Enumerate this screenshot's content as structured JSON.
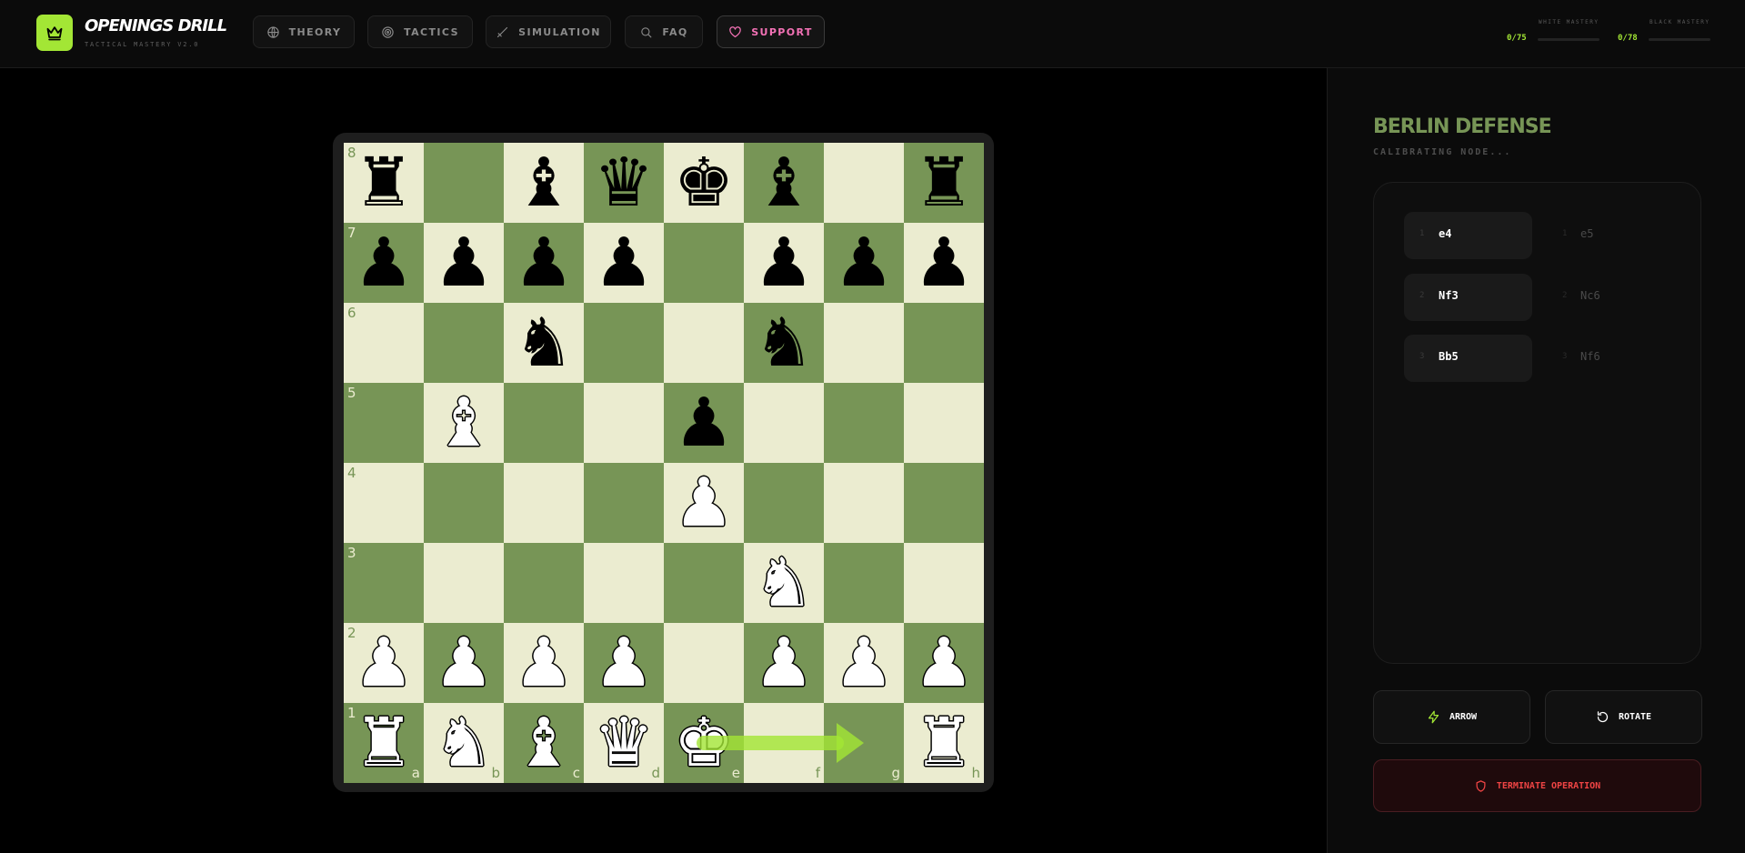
{
  "header": {
    "app_title": "OPENINGS DRILL",
    "app_subtitle": "TACTICAL MASTERY V2.0",
    "logo_icon": "crown-icon",
    "accent_color": "#a3e635",
    "nav": [
      {
        "label": "THEORY",
        "icon": "globe-icon"
      },
      {
        "label": "TACTICS",
        "icon": "target-icon"
      },
      {
        "label": "SIMULATION",
        "icon": "sword-icon"
      },
      {
        "label": "FAQ",
        "icon": "search-icon"
      },
      {
        "label": "SUPPORT",
        "icon": "heart-icon"
      }
    ],
    "white_mastery": {
      "label": "WHITE MASTERY",
      "value": "0/75",
      "fraction": 0
    },
    "black_mastery": {
      "label": "BLACK MASTERY",
      "value": "0/78",
      "fraction": 0
    }
  },
  "board": {
    "light_color": "#ebecd0",
    "dark_color": "#779556",
    "ranks": [
      "8",
      "7",
      "6",
      "5",
      "4",
      "3",
      "2",
      "1"
    ],
    "files": [
      "a",
      "b",
      "c",
      "d",
      "e",
      "f",
      "g",
      "h"
    ],
    "position": [
      [
        "r",
        "",
        "b",
        "q",
        "k",
        "b",
        "",
        "r"
      ],
      [
        "p",
        "p",
        "p",
        "p",
        "",
        "p",
        "p",
        "p"
      ],
      [
        "",
        "",
        "n",
        "",
        "",
        "n",
        "",
        ""
      ],
      [
        "",
        "B",
        "",
        "",
        "p",
        "",
        "",
        ""
      ],
      [
        "",
        "",
        "",
        "",
        "P",
        "",
        "",
        ""
      ],
      [
        "",
        "",
        "",
        "",
        "",
        "N",
        "",
        ""
      ],
      [
        "P",
        "P",
        "P",
        "P",
        "",
        "P",
        "P",
        "P"
      ],
      [
        "R",
        "N",
        "B",
        "Q",
        "K",
        "",
        "",
        "R"
      ]
    ],
    "arrow": {
      "from": "e1",
      "to": "g1",
      "color": "#a3e635"
    }
  },
  "panel": {
    "opening_name": "BERLIN DEFENSE",
    "status": "CALIBRATING NODE...",
    "moves": [
      {
        "num": "1",
        "white": "e4",
        "black": "e5"
      },
      {
        "num": "2",
        "white": "Nf3",
        "black": "Nc6"
      },
      {
        "num": "3",
        "white": "Bb5",
        "black": "Nf6"
      }
    ],
    "arrow_button": {
      "label": "ARROW",
      "icon": "lightning-icon"
    },
    "rotate_button": {
      "label": "ROTATE",
      "icon": "rotate-icon"
    },
    "terminate_button": {
      "label": "TERMINATE OPERATION",
      "icon": "shield-icon"
    }
  }
}
